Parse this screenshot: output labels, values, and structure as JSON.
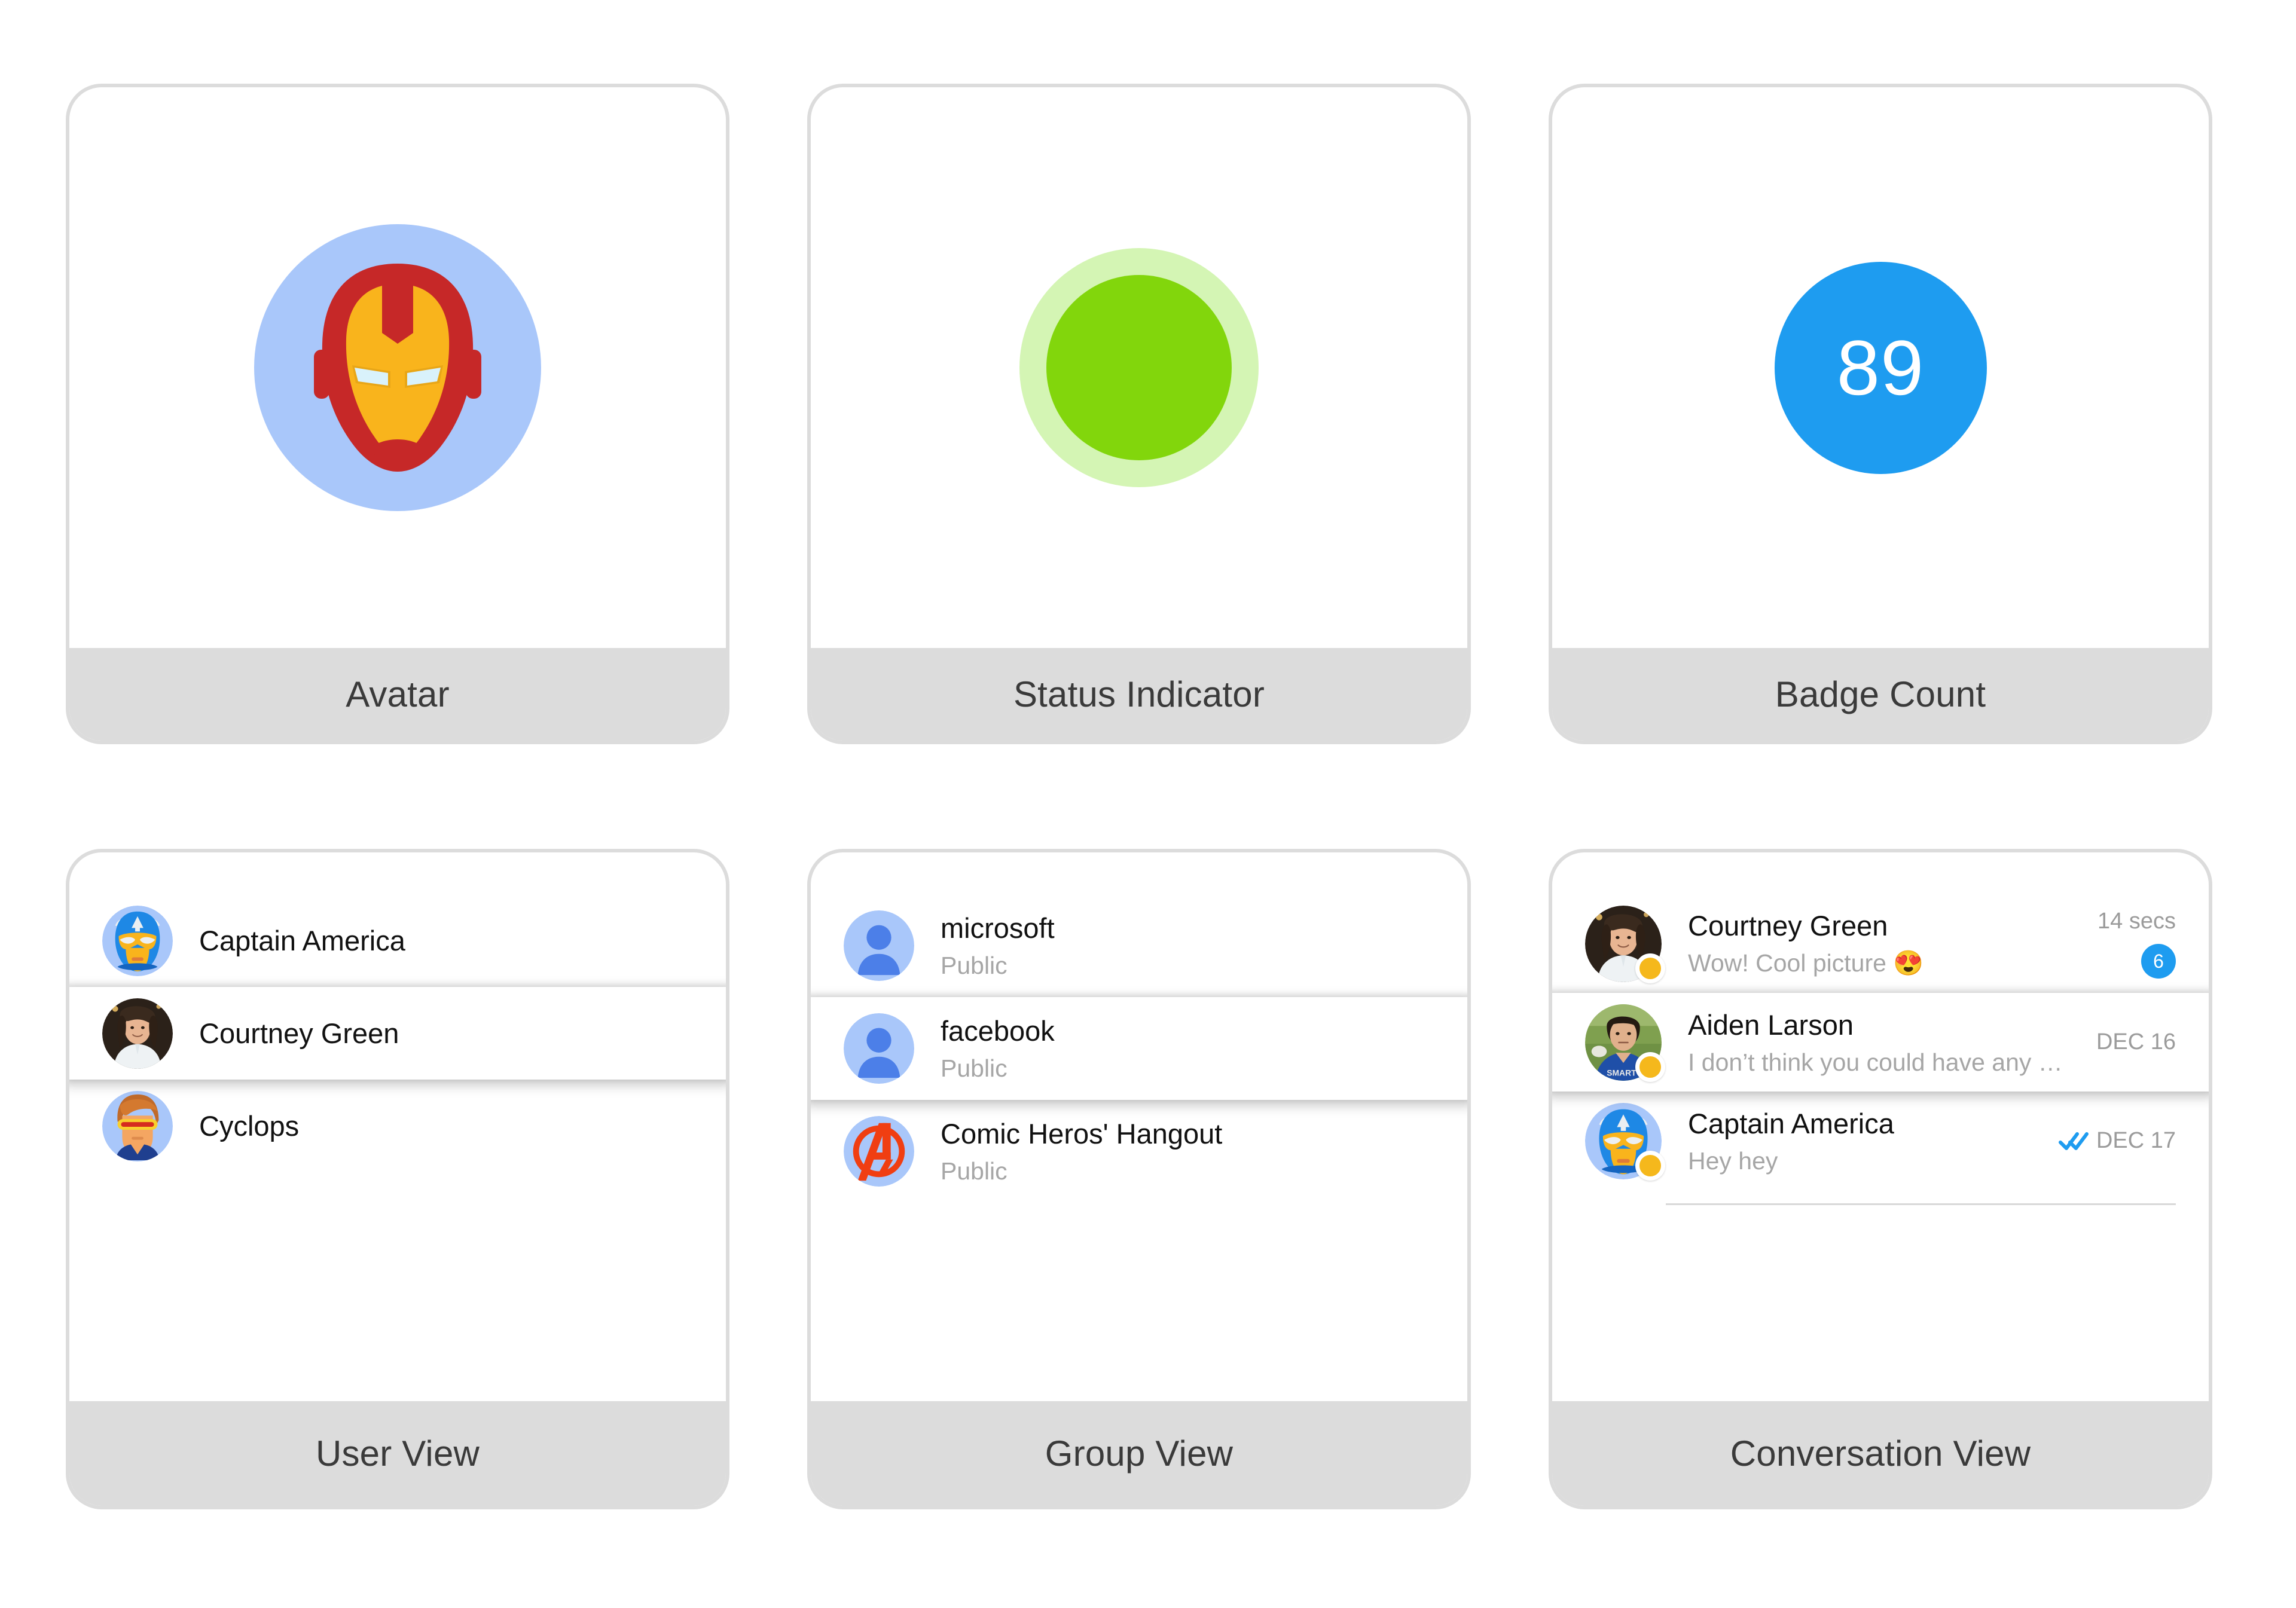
{
  "cards": [
    {
      "id": "avatar",
      "label": "Avatar",
      "icon": "ironman-avatar-icon"
    },
    {
      "id": "status",
      "label": "Status Indicator",
      "icon": "status-dot-icon",
      "status_color": "#82d60c",
      "status_halo_color": "#d4f5b4"
    },
    {
      "id": "badge",
      "label": "Badge Count",
      "icon": "badge-circle-icon",
      "badge_value": "89",
      "badge_color": "#1e9cf0"
    },
    {
      "id": "user-view",
      "label": "User View"
    },
    {
      "id": "group-view",
      "label": "Group View"
    },
    {
      "id": "conversation-view",
      "label": "Conversation View"
    }
  ],
  "user_view": {
    "rows": [
      {
        "name": "Captain America",
        "avatar": "captain-america-avatar-icon",
        "selected": false
      },
      {
        "name": "Courtney Green",
        "avatar": "courtney-green-photo",
        "selected": true
      },
      {
        "name": "Cyclops",
        "avatar": "cyclops-avatar-icon",
        "selected": false
      }
    ]
  },
  "group_view": {
    "rows": [
      {
        "name": "microsoft",
        "privacy": "Public",
        "avatar": "person-placeholder-icon",
        "selected": false
      },
      {
        "name": "facebook",
        "privacy": "Public",
        "avatar": "person-placeholder-icon",
        "selected": true
      },
      {
        "name": "Comic Heros' Hangout",
        "privacy": "Public",
        "avatar": "avengers-logo-icon",
        "selected": false
      }
    ]
  },
  "conversation_view": {
    "rows": [
      {
        "name": "Courtney Green",
        "preview": "Wow! Cool picture 😍",
        "time": "14 secs",
        "unread": "6",
        "read_receipt": false,
        "avatar": "courtney-green-photo",
        "presence": "online-away-dot-icon",
        "selected": false
      },
      {
        "name": "Aiden Larson",
        "preview": "I don’t think you could have any mone…",
        "time": "DEC 16",
        "unread": "",
        "read_receipt": false,
        "avatar": "aiden-larson-photo",
        "presence": "online-away-dot-icon",
        "selected": true
      },
      {
        "name": "Captain America",
        "preview": "Hey hey",
        "time": "DEC 17",
        "unread": "",
        "read_receipt": true,
        "avatar": "captain-america-avatar-icon",
        "presence": "online-away-dot-icon",
        "selected": false
      }
    ]
  },
  "colors": {
    "card_border": "#dcdcdc",
    "label_band": "#dcdcdc",
    "label_text": "#3a3a3a",
    "name_text": "#111111",
    "sub_text": "#a6a6a6",
    "accent_blue": "#1e9cf0",
    "presence_amber": "#f5b81c",
    "avatar_bg_blue": "#a9c7fa"
  }
}
